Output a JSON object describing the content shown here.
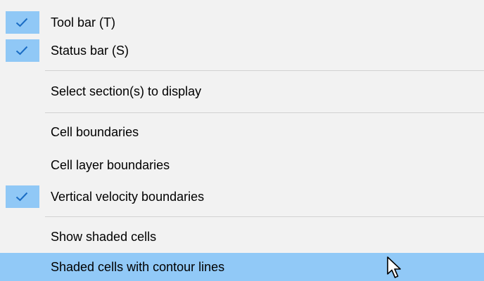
{
  "menu": {
    "items": [
      {
        "label": "Tool bar (T)",
        "checked": true,
        "highlighted": false
      },
      {
        "label": "Status bar (S)",
        "checked": true,
        "highlighted": false
      },
      {
        "label": "Select section(s) to display",
        "checked": false,
        "highlighted": false
      },
      {
        "label": "Cell boundaries",
        "checked": false,
        "highlighted": false
      },
      {
        "label": "Cell layer boundaries",
        "checked": false,
        "highlighted": false
      },
      {
        "label": "Vertical velocity boundaries",
        "checked": true,
        "highlighted": false
      },
      {
        "label": "Show shaded cells",
        "checked": false,
        "highlighted": false
      },
      {
        "label": "Shaded cells with contour lines",
        "checked": false,
        "highlighted": true
      }
    ]
  },
  "colors": {
    "menu_background": "#f2f2f2",
    "check_background": "#90c8f6",
    "highlight_background": "#91c9f7",
    "check_mark": "#1a6cc4",
    "separator": "#d2d2d2"
  },
  "icons": {
    "check": "check-icon",
    "cursor": "mouse-pointer-icon"
  }
}
